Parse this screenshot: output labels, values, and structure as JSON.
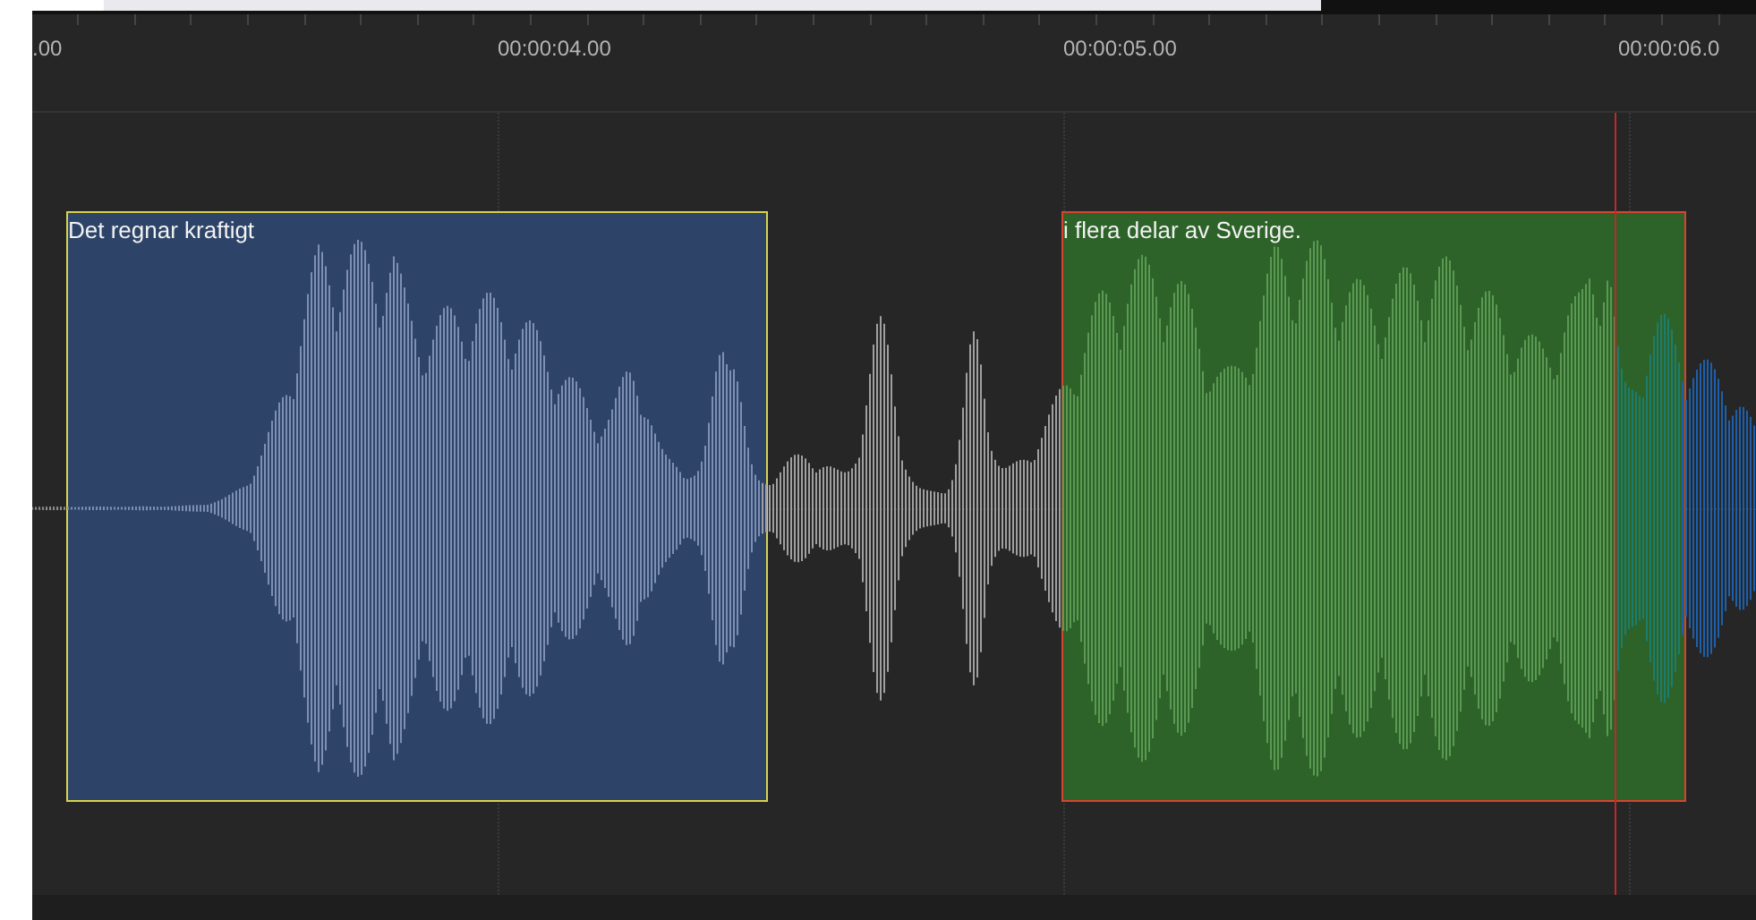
{
  "ruler": {
    "labels": [
      ".00",
      "00:00:04.00",
      "00:00:05.00",
      "00:00:06.0"
    ]
  },
  "segments": [
    {
      "text": "Det regnar kraftigt",
      "color": "#2d4468"
    },
    {
      "text": "i flera delar av Sverige.",
      "color": "#2d6329"
    }
  ]
}
